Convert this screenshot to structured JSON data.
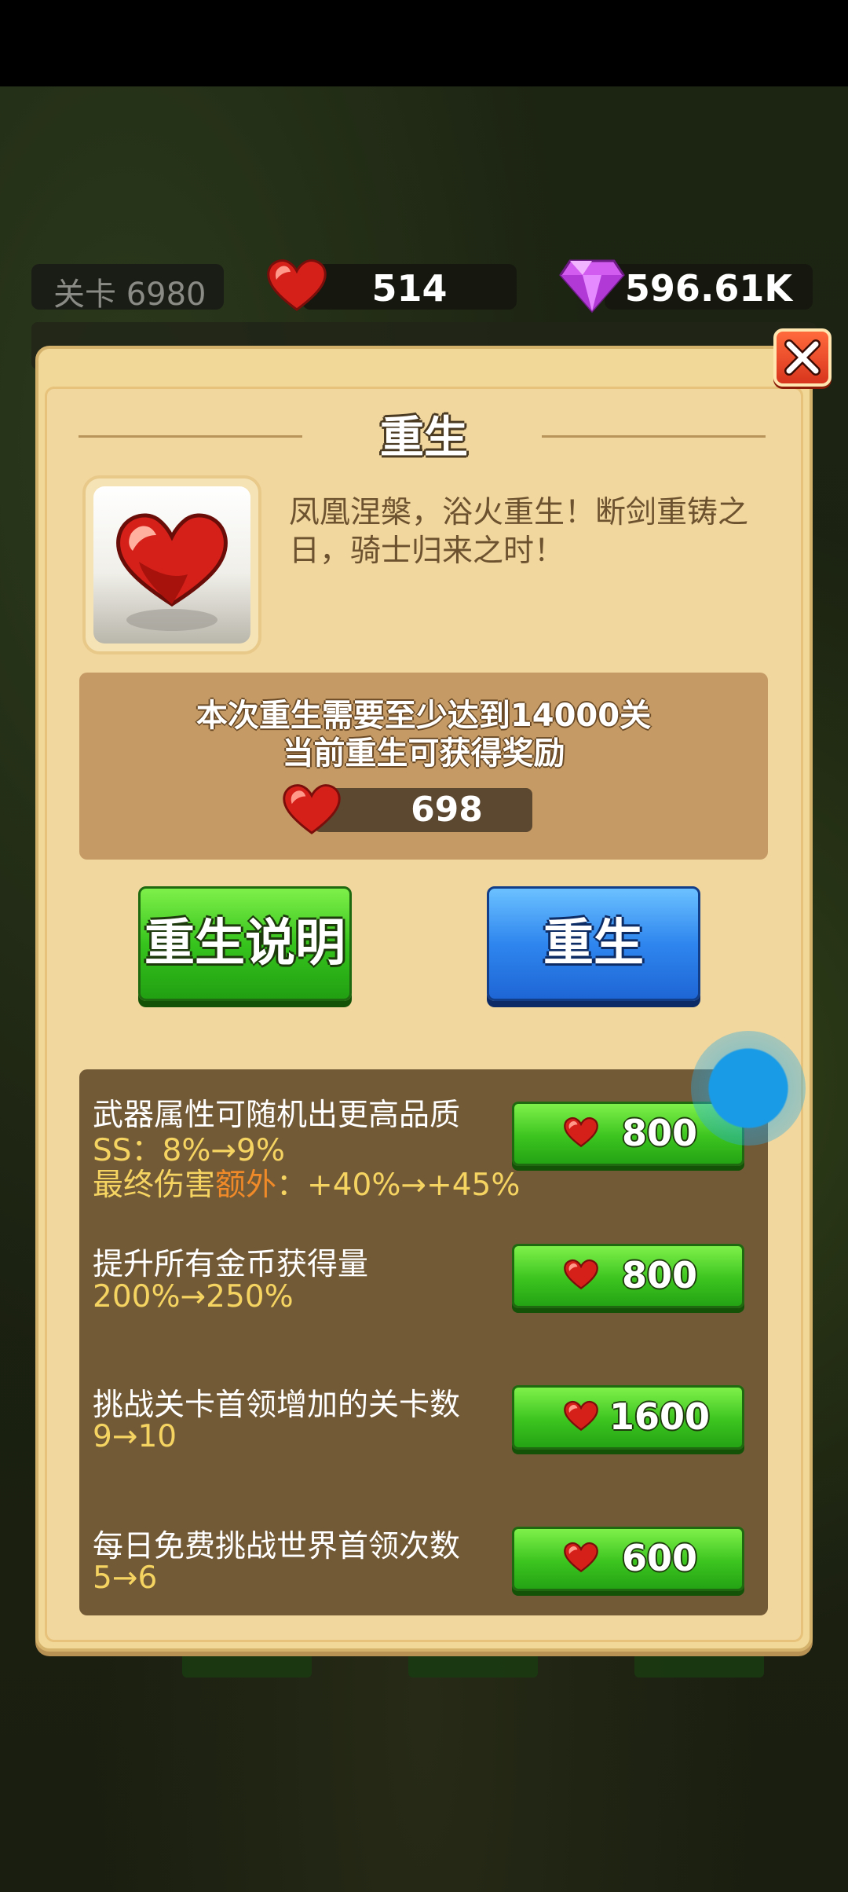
{
  "top_bar": {
    "level_label": "关卡 6980",
    "hearts": "514",
    "gems": "596.61K"
  },
  "dialog": {
    "title": "重生",
    "description_line1": "凤凰涅槃，浴火重生！断剑重铸之",
    "description_line2": "日，骑士归来之时！",
    "requirement_line1": "本次重生需要至少达到14000关",
    "requirement_line2": "当前重生可获得奖励",
    "reward_value": "698",
    "explain_button": "重生说明",
    "rebirth_button": "重生"
  },
  "upgrades": [
    {
      "title": "武器属性可随机出更高品质",
      "line1": "SS：8%→9%",
      "line2_prefix": "最终伤害",
      "line2_highlight": "额外",
      "line2_suffix": "：+40%→+45%",
      "cost": "800"
    },
    {
      "title": "提升所有金币获得量",
      "line1": "200%→250%",
      "cost": "800"
    },
    {
      "title": "挑战关卡首领增加的关卡数",
      "line1": "9→10",
      "cost": "1600"
    },
    {
      "title": "每日免费挑战世界首领次数",
      "line1": "5→6",
      "cost": "600"
    }
  ],
  "colors": {
    "panel": "#f2d898",
    "green_button": "#37c41d",
    "blue_button": "#2f86ee",
    "upgrade_box": "#735a37",
    "highlight_yellow": "#f6d462",
    "highlight_orange": "#f08a28"
  },
  "icons": {
    "currency": "heart-icon",
    "premium": "gem-icon",
    "close": "close-icon"
  }
}
